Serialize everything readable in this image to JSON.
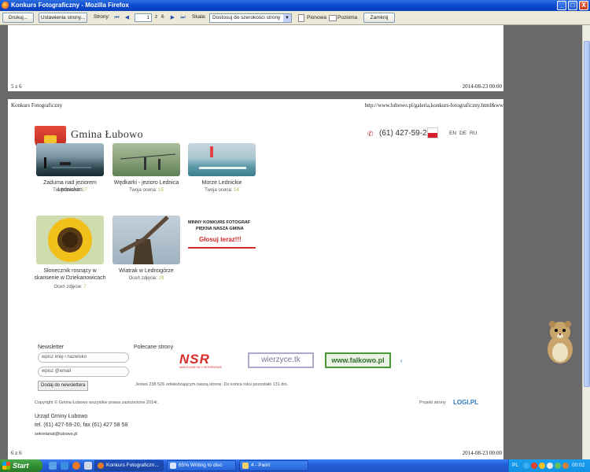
{
  "window": {
    "title": "Konkurs Fotograficzny - Mozilla Firefox",
    "controls": {
      "minimize": "_",
      "maximize": "□",
      "close": "X"
    }
  },
  "toolbar": {
    "print_label": "Drukuj...",
    "page_setup_label": "Ustawienia strony...",
    "pages_label": "Strony:",
    "current_page": "1",
    "of_label": "z",
    "total_pages": "6",
    "scale_label": "Skala:",
    "scale_value": "Dostosuj do szerokości strony",
    "portrait_label": "Pionowa",
    "landscape_label": "Pozioma",
    "close_label": "Zamknij"
  },
  "page_prev": {
    "footer_left": "5 z 6",
    "footer_right": "2014-08-23 00:00"
  },
  "page_current": {
    "header_left": "Konkurs Fotograficzny",
    "header_right": "http://www.lubowo.pl/galeria,konkurs-fotograficzny.html&ww",
    "footer_left": "6 z 6",
    "footer_right": "2014-08-23 00:00"
  },
  "site": {
    "brand": "Gmina Łubowo",
    "phone": "(61) 427-59-20",
    "langs": [
      "EN",
      "DE",
      "RU"
    ],
    "photos": [
      {
        "caption": "Zaduma nad jeziorem Lednickim",
        "rating_label": "Twoja ocena:",
        "rating_value": "17"
      },
      {
        "caption": "Wędkarki - jezioro Lednica",
        "rating_label": "Twoja ocena:",
        "rating_value": "15"
      },
      {
        "caption": "Morze Lednickie",
        "rating_label": "Twoja ocena:",
        "rating_value": "14"
      },
      {
        "caption": "Słonecznik rosnący w skansenie w Dziekanowicach",
        "rating_label": "Oceń zdjęcie:",
        "rating_value": "7"
      },
      {
        "caption": "Wiatrak w Lednogórze",
        "rating_label": "Oceń zdjęcie:",
        "rating_value": "29"
      }
    ],
    "banner": {
      "line1": "MINNY KONKURS FOTOGRAF",
      "line2": "PIĘKNA NASZA GMINA",
      "cta": "Głosuj teraz!!!"
    },
    "newsletter": {
      "title": "Newsletter",
      "name_placeholder": "wpisz imię i nazwisko",
      "email_placeholder": "wpisz @email",
      "button": "Dodaj do newslettera"
    },
    "recommended": {
      "title": "Polecane strony",
      "partners": [
        "NSR",
        "NARODOWE SIŁY REZERWOWE",
        "wierzyce.tk",
        "www.falkowo.pl"
      ]
    },
    "counter": "Jesteś 238 526 odwiedzającym naszą stronę. Do końca roku pozostało 131 dni.",
    "copyright": "Copyright © Gmina Łubowo wszystkie prawa zastrzeżone 2014r.",
    "projekt_label": "Projekt strony",
    "projekt_brand": "LOGI.PL",
    "office": {
      "name": "Urząd Gminy Łubowo",
      "phones": "tel. (61) 427-59-20, fax (61) 427 58 58",
      "email": "sekretariat@lubowo.pl"
    }
  },
  "taskbar": {
    "start": "Start",
    "tasks": [
      {
        "label": "Konkurs Fotograficzn...",
        "active": true
      },
      {
        "label": "65% Writing to disc",
        "active": false
      },
      {
        "label": "4 - Paint",
        "active": false
      }
    ],
    "lang": "PL",
    "clock": "00:02"
  },
  "colors": {
    "xp_blue": "#245edb",
    "start_green": "#2f8a30",
    "preview_gray": "#696969",
    "nsr_red": "#d92a2a",
    "falkowo_green": "#4a9a3a",
    "rating_green": "#a5b54d"
  }
}
